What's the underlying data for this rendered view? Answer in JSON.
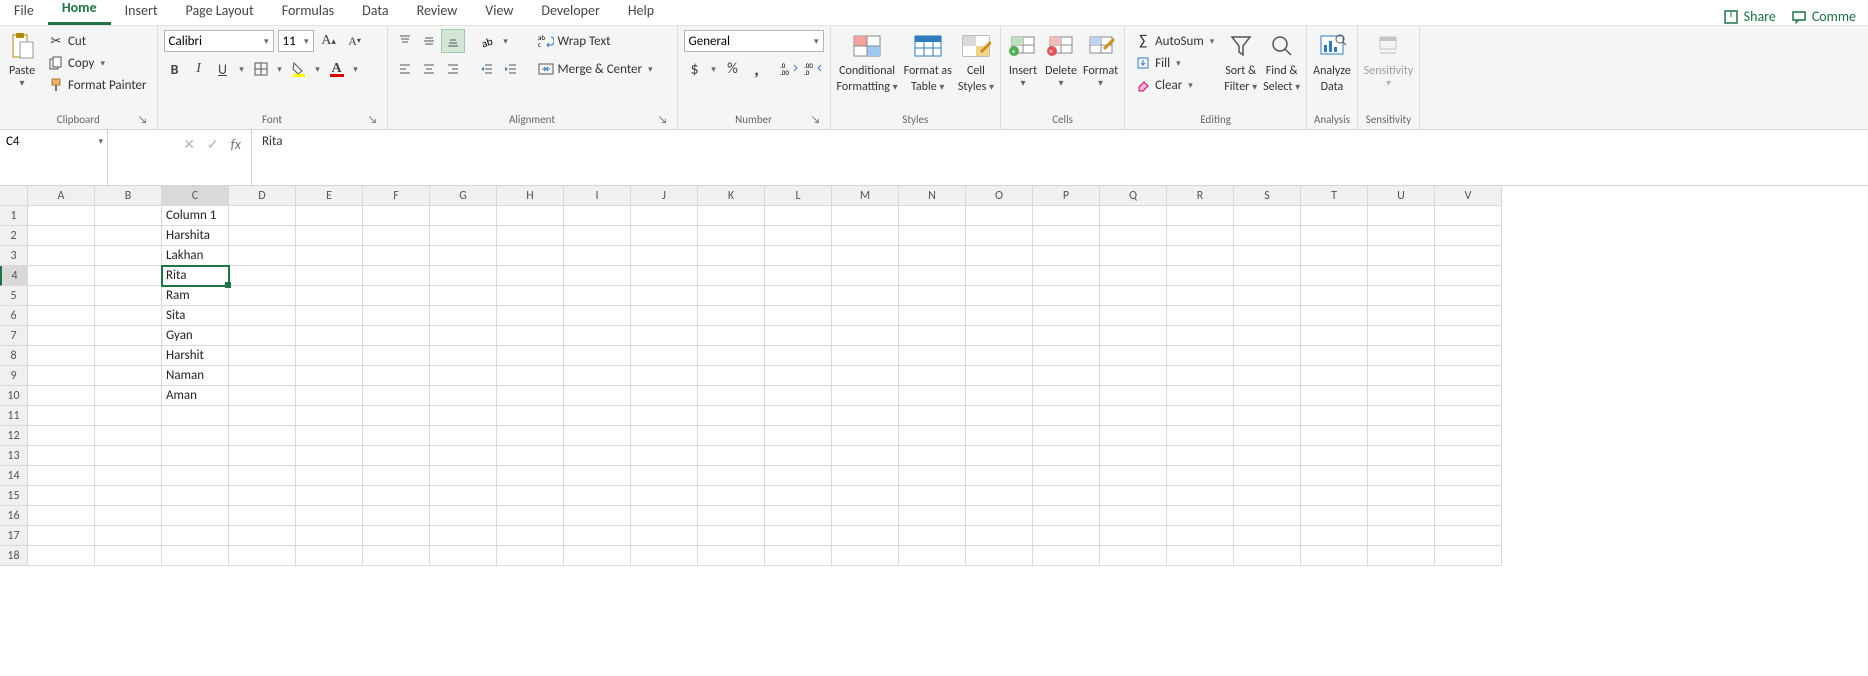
{
  "tabs": {
    "items": [
      "File",
      "Home",
      "Insert",
      "Page Layout",
      "Formulas",
      "Data",
      "Review",
      "View",
      "Developer",
      "Help"
    ],
    "active": "Home"
  },
  "topRight": {
    "share": "Share",
    "comments": "Comme"
  },
  "ribbon": {
    "clipboard": {
      "paste": "Paste",
      "cut": "Cut",
      "copy": "Copy",
      "formatPainter": "Format Painter",
      "label": "Clipboard"
    },
    "font": {
      "name": "Calibri",
      "size": "11",
      "label": "Font"
    },
    "alignment": {
      "wrap": "Wrap Text",
      "merge": "Merge & Center",
      "label": "Alignment"
    },
    "number": {
      "format": "General",
      "label": "Number"
    },
    "styles": {
      "cond": "Conditional",
      "cond2": "Formatting",
      "fmt": "Format as",
      "fmt2": "Table",
      "cell": "Cell",
      "cell2": "Styles",
      "label": "Styles"
    },
    "cells": {
      "insert": "Insert",
      "delete": "Delete",
      "format": "Format",
      "label": "Cells"
    },
    "editing": {
      "autosum": "AutoSum",
      "fill": "Fill",
      "clear": "Clear",
      "sort": "Sort &",
      "sort2": "Filter",
      "find": "Find &",
      "find2": "Select",
      "label": "Editing"
    },
    "analysis": {
      "analyze": "Analyze",
      "analyze2": "Data",
      "label": "Analysis"
    },
    "sensitivity": {
      "sens": "Sensitivity",
      "label": "Sensitivity"
    }
  },
  "formulaBar": {
    "nameBox": "C4",
    "formula": "Rita"
  },
  "grid": {
    "columns": [
      "A",
      "B",
      "C",
      "D",
      "E",
      "F",
      "G",
      "H",
      "I",
      "J",
      "K",
      "L",
      "M",
      "N",
      "O",
      "P",
      "Q",
      "R",
      "S",
      "T",
      "U",
      "V"
    ],
    "rows": 18,
    "selected": {
      "row": 4,
      "col": "C"
    },
    "cells": {
      "C1": "Column 1",
      "C2": "Harshita",
      "C3": "Lakhan",
      "C4": "Rita",
      "C5": "Ram",
      "C6": "Sita",
      "C7": "Gyan",
      "C8": "Harshit",
      "C9": "Naman",
      "C10": "Aman"
    }
  }
}
